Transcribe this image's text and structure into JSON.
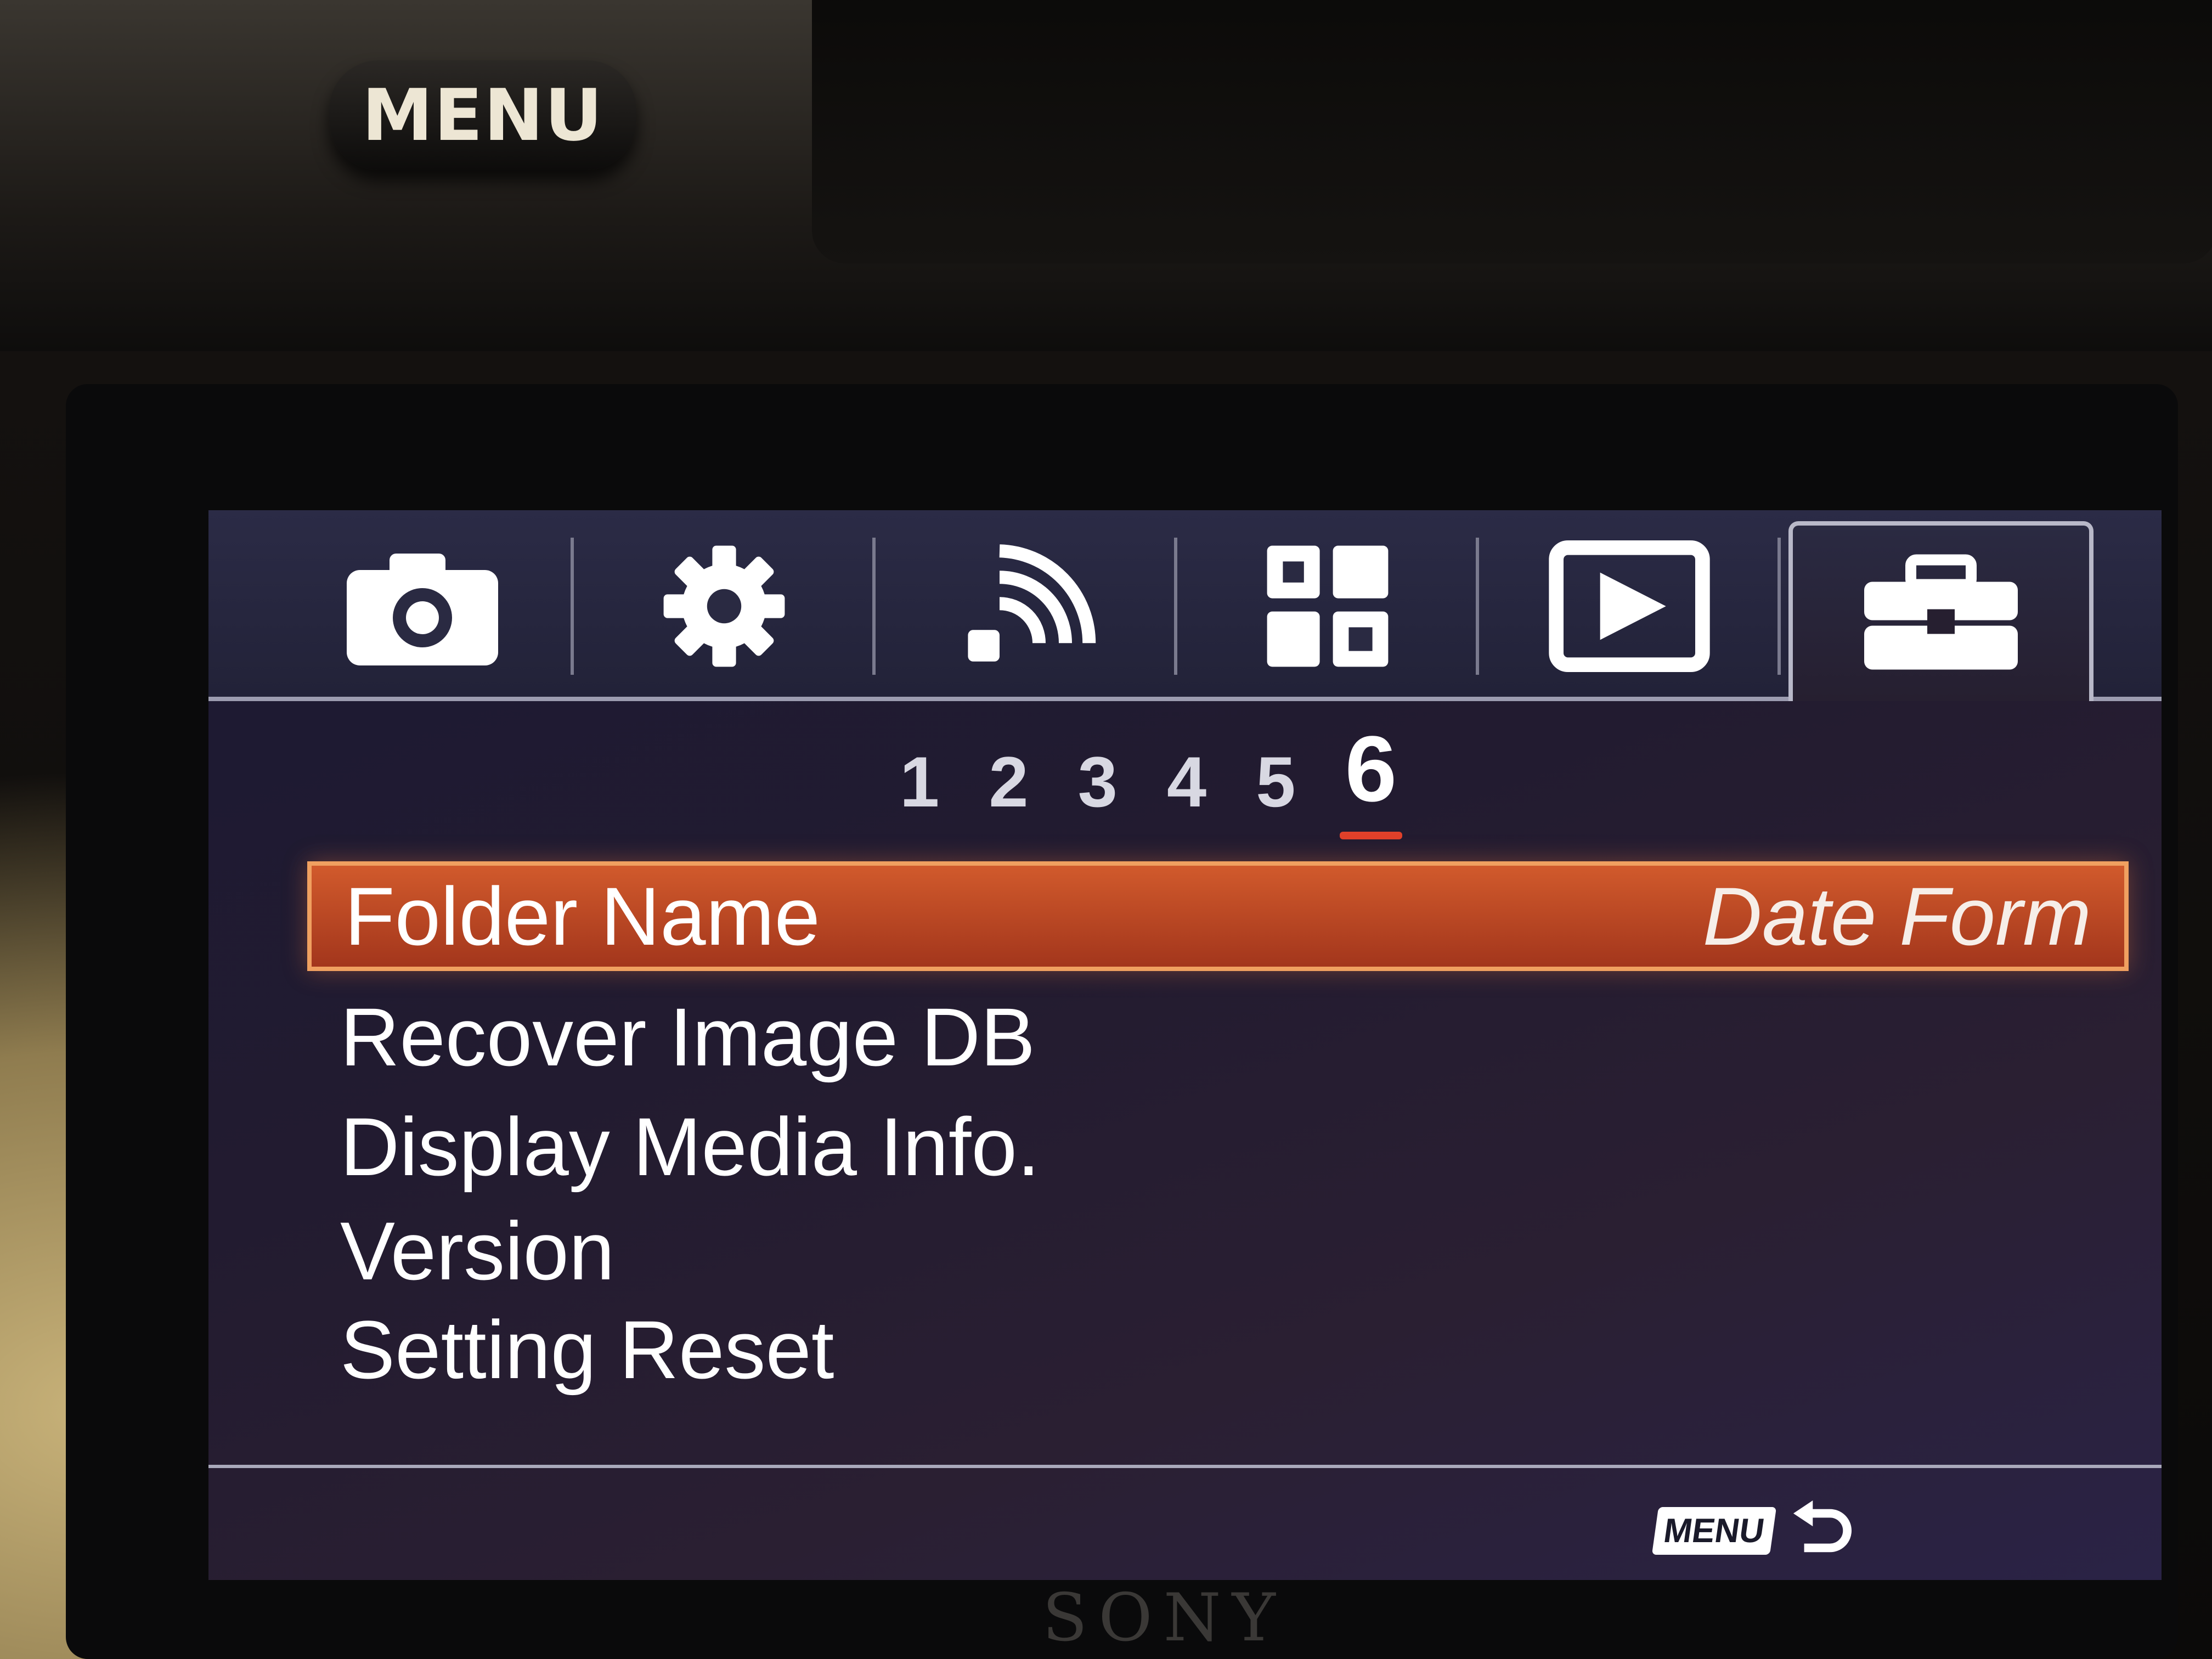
{
  "hardware": {
    "menu_button_label": "MENU",
    "brand": "SONY"
  },
  "tabs": [
    {
      "icon": "camera-icon",
      "active": false
    },
    {
      "icon": "gear-icon",
      "active": false
    },
    {
      "icon": "wireless-icon",
      "active": false
    },
    {
      "icon": "apps-grid-icon",
      "active": false
    },
    {
      "icon": "playback-icon",
      "active": false
    },
    {
      "icon": "toolbox-icon",
      "active": true
    }
  ],
  "pages": [
    "1",
    "2",
    "3",
    "4",
    "5",
    "6"
  ],
  "active_page": "6",
  "menu_items": [
    {
      "label": "Folder Name",
      "value": "Date Form",
      "selected": true
    },
    {
      "label": "Recover Image DB",
      "value": "",
      "selected": false
    },
    {
      "label": "Display Media Info.",
      "value": "",
      "selected": false
    },
    {
      "label": "Version",
      "value": "",
      "selected": false
    },
    {
      "label": "Setting Reset",
      "value": "",
      "selected": false
    }
  ],
  "footer": {
    "menu_badge": "MENU",
    "back_icon": "back-arrow-icon"
  },
  "colors": {
    "selection": "#c2482a",
    "active_page_underline": "#e0412a"
  }
}
